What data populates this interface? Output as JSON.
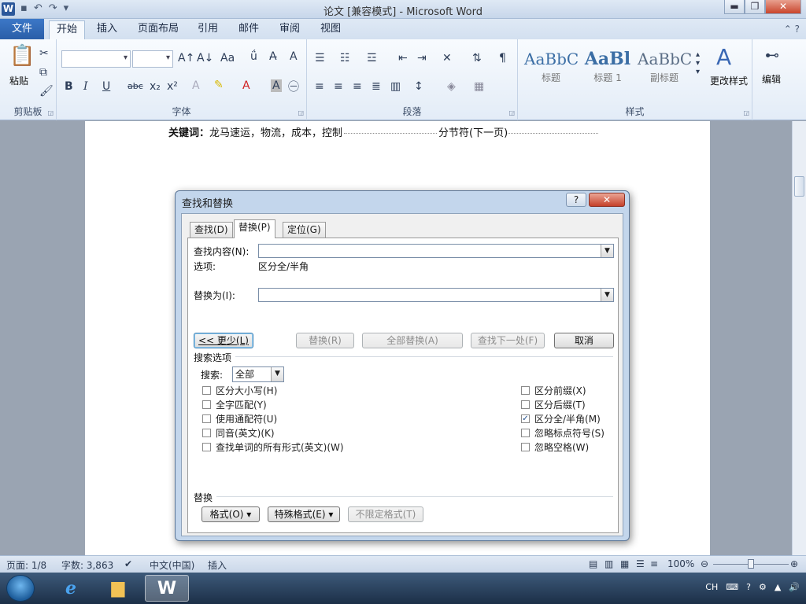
{
  "window": {
    "title": "论文 [兼容模式] - Microsoft Word",
    "logo_letter": "W",
    "controls": {
      "minimize": "▬",
      "restore": "❐",
      "close": "✕"
    }
  },
  "ribbon_tabs": [
    {
      "label": "文件"
    },
    {
      "label": "开始"
    },
    {
      "label": "插入"
    },
    {
      "label": "页面布局"
    },
    {
      "label": "引用"
    },
    {
      "label": "邮件"
    },
    {
      "label": "审阅"
    },
    {
      "label": "视图"
    }
  ],
  "ribbon": {
    "clipboard": {
      "paste": "粘贴",
      "group": "剪贴板"
    },
    "font": {
      "group": "字体",
      "grow": "A↑",
      "shrink": "A↓",
      "case": "Aa",
      "clear": "A",
      "bold": "B",
      "italic": "I",
      "underline": "U",
      "strike": "abc",
      "sub": "x₂",
      "sup": "x²",
      "color": "A"
    },
    "paragraph": {
      "group": "段落"
    },
    "styles": {
      "group": "样式",
      "items": [
        {
          "preview": "AaBbC",
          "caption": "标题"
        },
        {
          "preview": "AaBl",
          "caption": "标题 1"
        },
        {
          "preview": "AaBbC",
          "caption": "副标题"
        }
      ],
      "change_styles": "更改样式"
    },
    "editing": {
      "label": "编辑"
    }
  },
  "document": {
    "keyword_label": "关键词：",
    "keyword_text": "龙马速运，物流，成本，控制",
    "section_break": "分节符(下一页)"
  },
  "dialog": {
    "title": "查找和替换",
    "help": "?",
    "close": "✕",
    "tabs": [
      {
        "label": "查找(D)"
      },
      {
        "label": "替换(P)"
      },
      {
        "label": "定位(G)"
      }
    ],
    "find_label": "查找内容(N):",
    "find_value": "",
    "options_label": "选项:",
    "options_value": "区分全/半角",
    "replace_label": "替换为(I):",
    "replace_value": "",
    "buttons": {
      "less": "<< 更少(L)",
      "replace": "替换(R)",
      "replace_all": "全部替换(A)",
      "find_next": "查找下一处(F)",
      "cancel": "取消"
    },
    "search_options_title": "搜索选项",
    "search_label": "搜索:",
    "search_value": "全部",
    "left_checks": [
      {
        "label": "区分大小写(H)",
        "checked": false
      },
      {
        "label": "全字匹配(Y)",
        "checked": false
      },
      {
        "label": "使用通配符(U)",
        "checked": false
      },
      {
        "label": "同音(英文)(K)",
        "checked": false
      },
      {
        "label": "查找单词的所有形式(英文)(W)",
        "checked": false
      }
    ],
    "right_checks": [
      {
        "label": "区分前缀(X)",
        "checked": false
      },
      {
        "label": "区分后缀(T)",
        "checked": false
      },
      {
        "label": "区分全/半角(M)",
        "checked": true
      },
      {
        "label": "忽略标点符号(S)",
        "checked": false
      },
      {
        "label": "忽略空格(W)",
        "checked": false
      }
    ],
    "replace_section_title": "替换",
    "format_buttons": {
      "format": "格式(O) ▾",
      "special": "特殊格式(E) ▾",
      "no_format": "不限定格式(T)"
    }
  },
  "statusbar": {
    "page": "页面: 1/8",
    "words": "字数: 3,863",
    "language": "中文(中国)",
    "mode": "插入",
    "zoom": "100%",
    "zoom_minus": "⊖",
    "zoom_plus": "⊕"
  },
  "taskbar": {
    "ie_letter": "e",
    "word_letter": "W",
    "tray_lang": "CH"
  }
}
